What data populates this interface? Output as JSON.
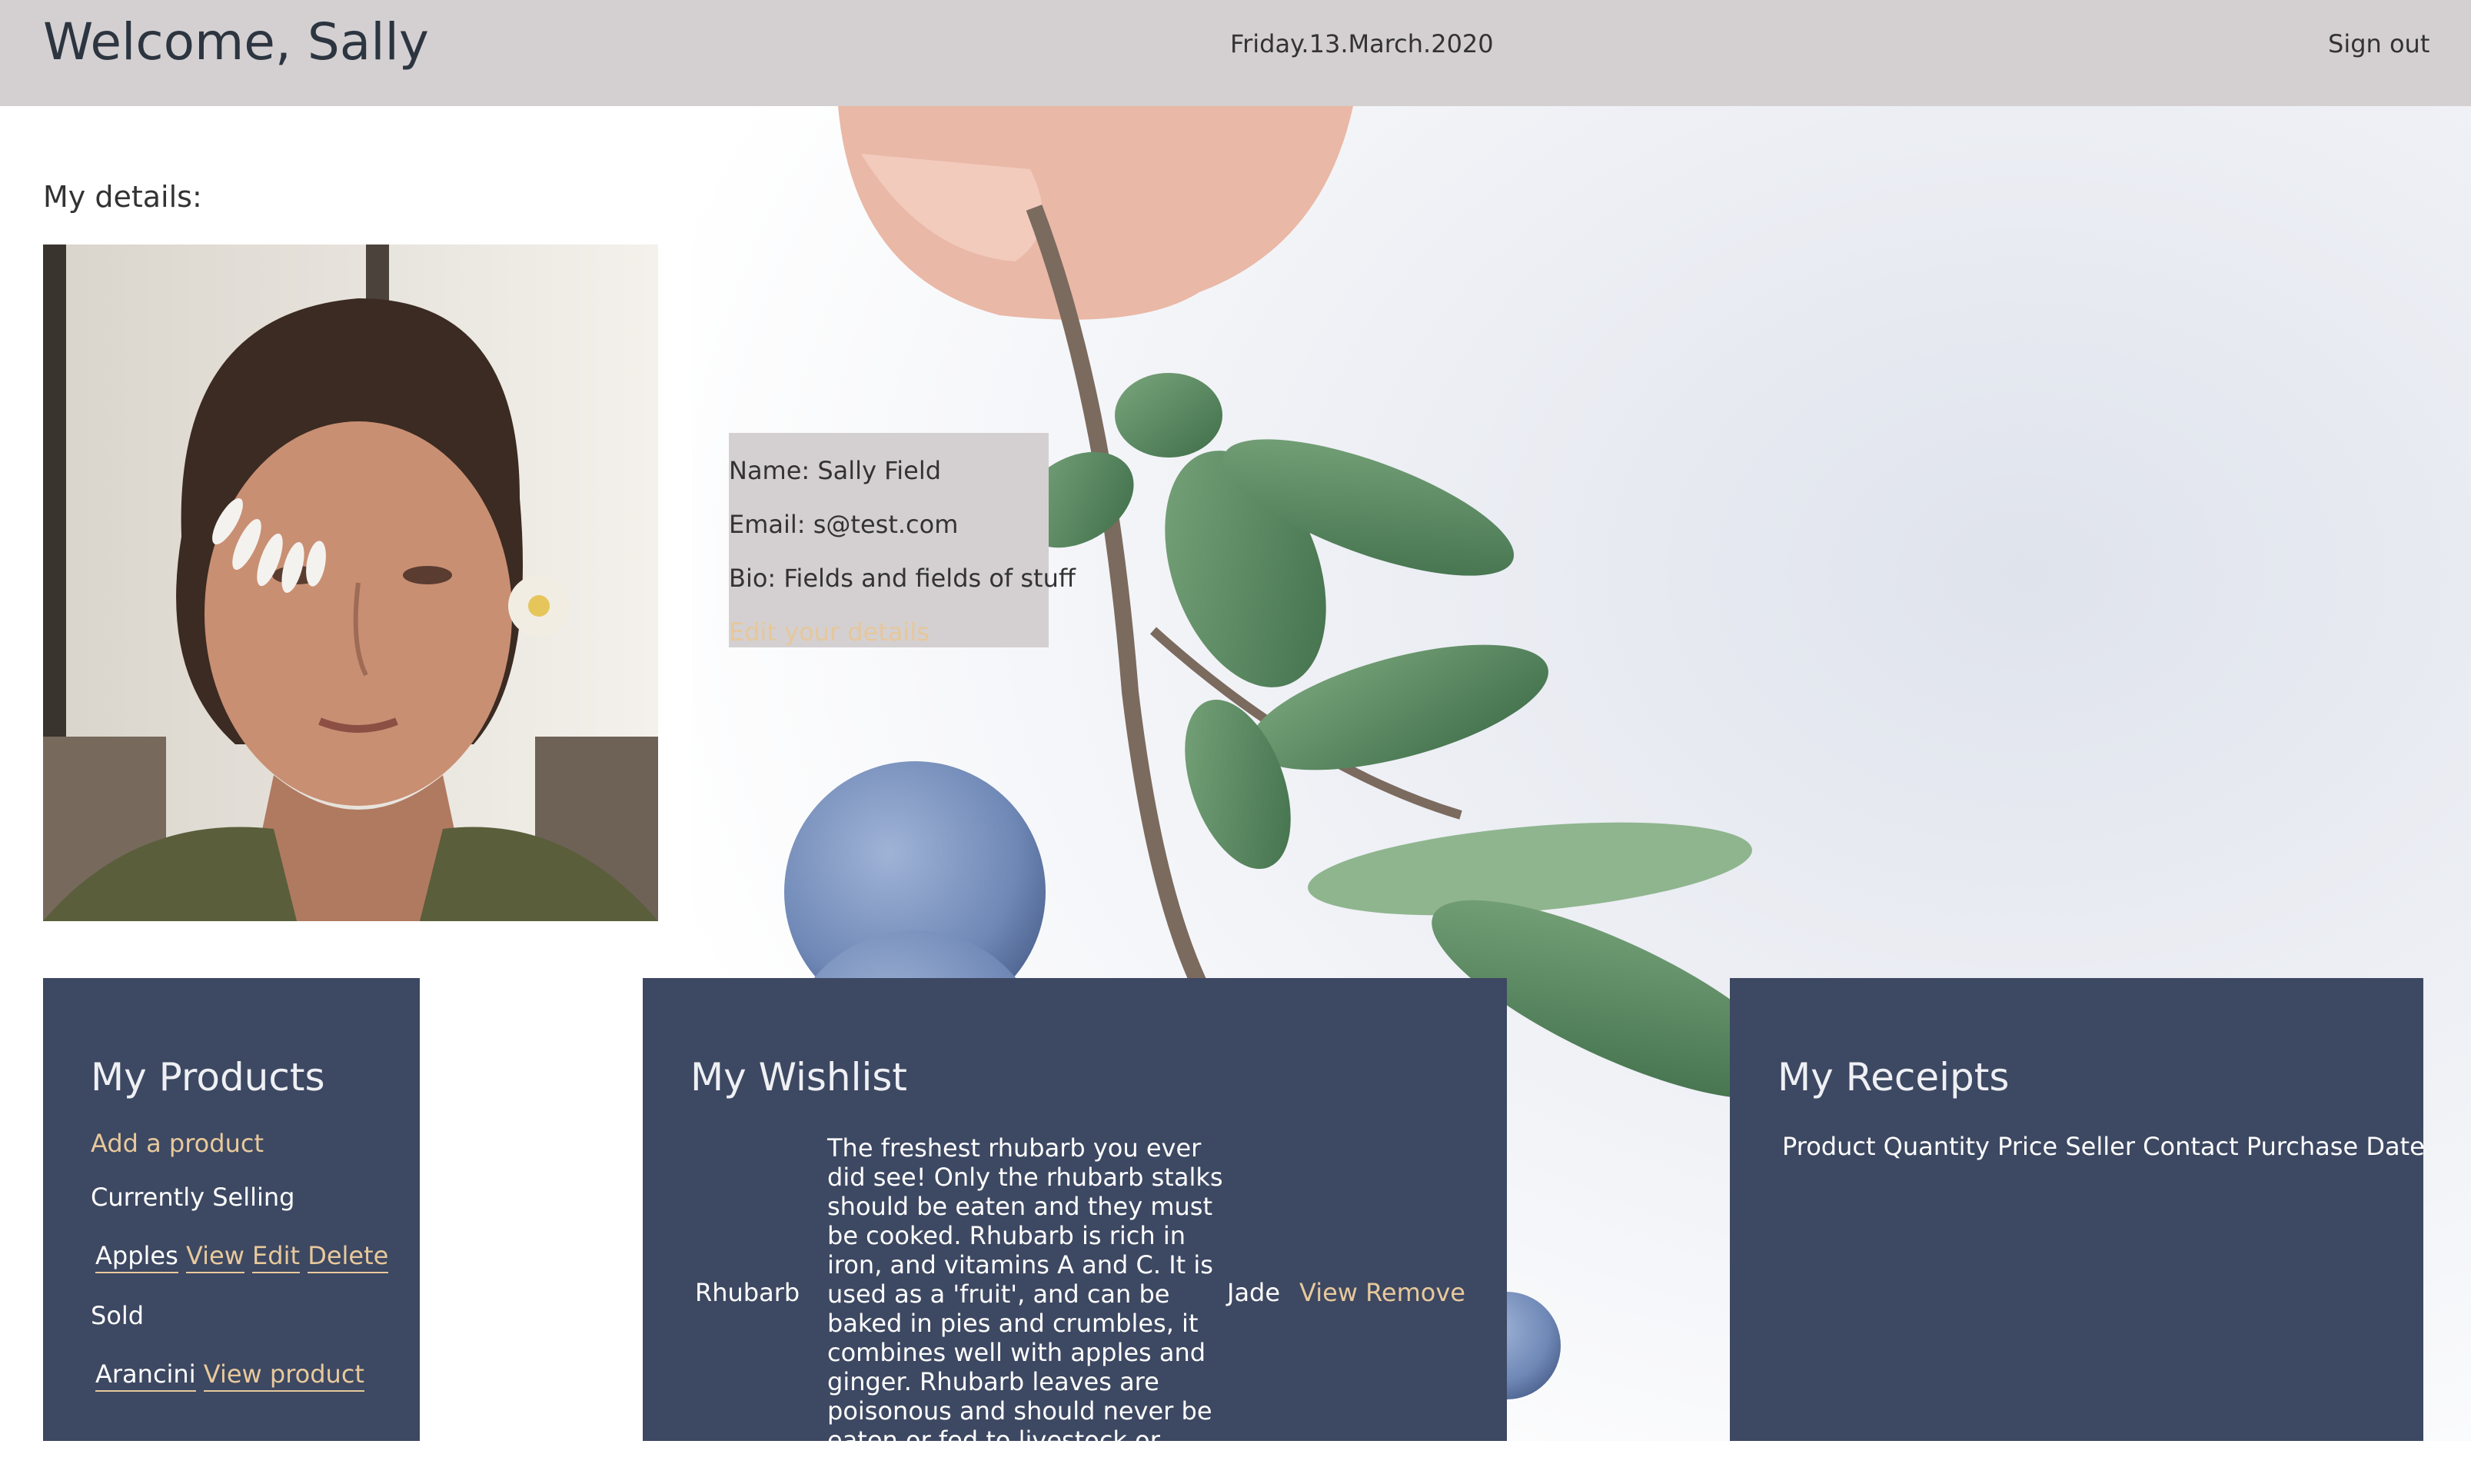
{
  "header": {
    "welcome": "Welcome, Sally",
    "date": "Friday.13.March.2020",
    "sign_out": "Sign out"
  },
  "details": {
    "label": "My details:",
    "name_line": "Name: Sally Field",
    "email_line": "Email: s@test.com",
    "bio_line": "Bio: Fields and fields of stuff",
    "edit_link": "Edit your details"
  },
  "products": {
    "title": "My Products",
    "add_link": "Add a product",
    "selling_heading": "Currently Selling",
    "selling": [
      {
        "name": "Apples",
        "view": "View",
        "edit": "Edit",
        "delete": "Delete"
      }
    ],
    "sold_heading": "Sold",
    "sold": [
      {
        "name": "Arancini",
        "view": "View product"
      }
    ]
  },
  "wishlist": {
    "title": "My Wishlist",
    "items": [
      {
        "name": "Rhubarb",
        "description": "The freshest rhubarb you ever did see! Only the rhubarb stalks should be eaten and they must be cooked. Rhubarb is rich in iron, and vitamins A and C. It is used as a 'fruit', and can be baked in pies and crumbles, it combines well with apples and ginger. Rhubarb leaves are poisonous and should never be eaten or fed to livestock or poultry.",
        "seller": "Jade",
        "view": "View",
        "remove": "Remove"
      }
    ]
  },
  "receipts": {
    "title": "My Receipts",
    "columns": [
      "Product",
      "Quantity",
      "Price",
      "Seller",
      "Contact",
      "Purchase Date"
    ]
  },
  "colors": {
    "header_bg": "#d4d0d1",
    "panel_bg": "#3d4862",
    "link_gold": "#e8c99c"
  }
}
